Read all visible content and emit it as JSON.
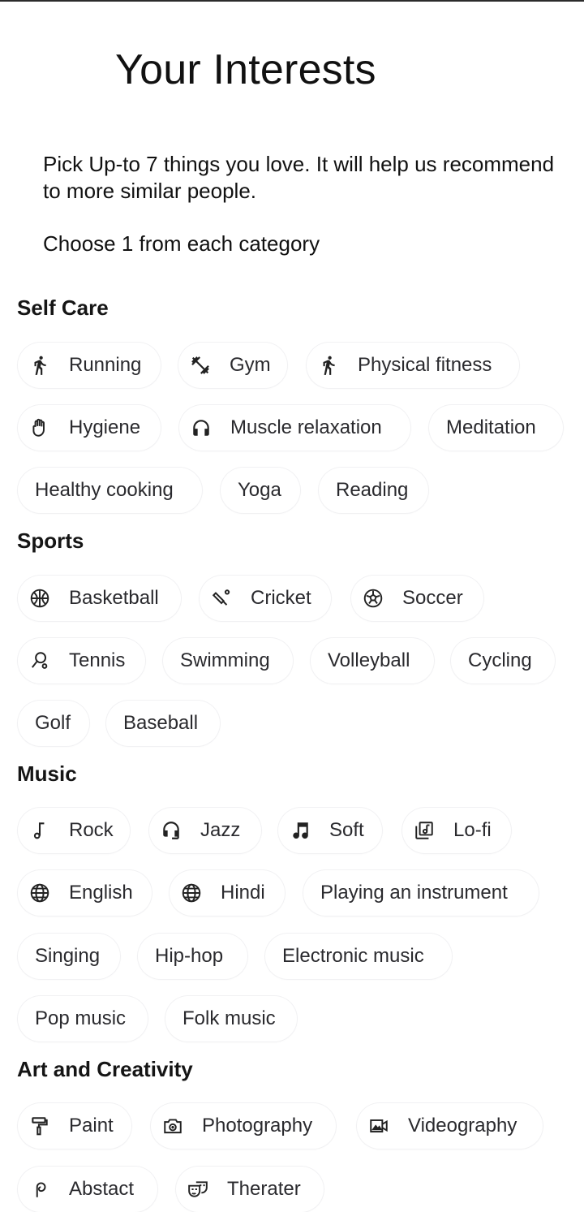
{
  "header": {
    "title": "Your Interests",
    "intro": "Pick Up-to 7 things you love. It will help us recommend to more similar people.",
    "choose": "Choose 1 from each category"
  },
  "categories": [
    {
      "name": "Self Care",
      "chips": [
        {
          "label": "Running",
          "icon": "running-icon"
        },
        {
          "label": "Gym",
          "icon": "dumbbell-icon"
        },
        {
          "label": "Physical fitness",
          "icon": "walking-icon"
        },
        {
          "label": "Hygiene",
          "icon": "hand-icon"
        },
        {
          "label": "Muscle relaxation",
          "icon": "headphones-icon"
        },
        {
          "label": "Meditation",
          "icon": ""
        },
        {
          "label": "Healthy cooking",
          "icon": ""
        },
        {
          "label": "Yoga",
          "icon": ""
        },
        {
          "label": "Reading",
          "icon": ""
        }
      ]
    },
    {
      "name": "Sports",
      "chips": [
        {
          "label": "Basketball",
          "icon": "basketball-icon"
        },
        {
          "label": "Cricket",
          "icon": "cricket-icon"
        },
        {
          "label": "Soccer",
          "icon": "soccer-ball-icon"
        },
        {
          "label": "Tennis",
          "icon": "tennis-racket-icon"
        },
        {
          "label": "Swimming",
          "icon": ""
        },
        {
          "label": "Volleyball",
          "icon": ""
        },
        {
          "label": "Cycling",
          "icon": ""
        },
        {
          "label": "Golf",
          "icon": ""
        },
        {
          "label": "Baseball",
          "icon": ""
        }
      ]
    },
    {
      "name": "Music",
      "chips": [
        {
          "label": "Rock",
          "icon": "music-note-icon"
        },
        {
          "label": "Jazz",
          "icon": "headset-icon"
        },
        {
          "label": "Soft",
          "icon": "music-notes-icon"
        },
        {
          "label": "Lo-fi",
          "icon": "library-music-icon"
        },
        {
          "label": "English",
          "icon": "globe-icon"
        },
        {
          "label": "Hindi",
          "icon": "globe-icon"
        },
        {
          "label": "Playing an instrument",
          "icon": ""
        },
        {
          "label": "Singing",
          "icon": ""
        },
        {
          "label": "Hip-hop",
          "icon": ""
        },
        {
          "label": "Electronic music",
          "icon": ""
        },
        {
          "label": "Pop music",
          "icon": ""
        },
        {
          "label": "Folk music",
          "icon": ""
        }
      ]
    },
    {
      "name": "Art and Creativity",
      "chips": [
        {
          "label": "Paint",
          "icon": "paint-roller-icon"
        },
        {
          "label": "Photography",
          "icon": "camera-icon"
        },
        {
          "label": "Videography",
          "icon": "video-camera-icon"
        },
        {
          "label": "Abstact",
          "icon": "abstract-icon"
        },
        {
          "label": "Therater",
          "icon": "theater-masks-icon"
        }
      ]
    }
  ]
}
